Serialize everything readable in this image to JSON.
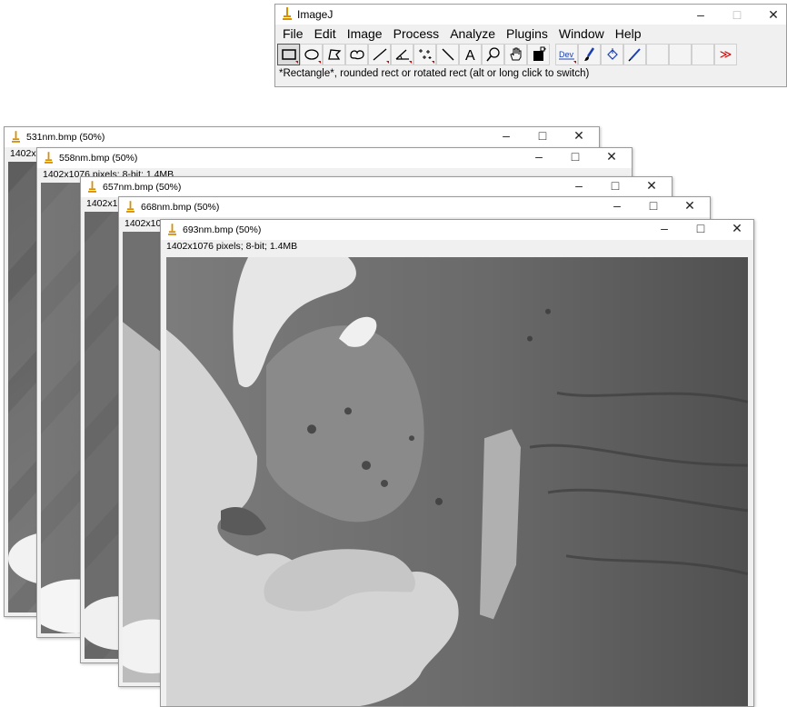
{
  "main": {
    "title": "ImageJ",
    "menus": [
      "File",
      "Edit",
      "Image",
      "Process",
      "Analyze",
      "Plugins",
      "Window",
      "Help"
    ],
    "toolbar": {
      "dev_label": "Dev",
      "overflow": "≫"
    },
    "status": "*Rectangle*, rounded rect or rotated rect (alt or long click to switch)",
    "controls": {
      "minimize": "–",
      "maximize": "□",
      "close": "✕"
    }
  },
  "windows": [
    {
      "title": "531nm.bmp (50%)",
      "info": "1402x"
    },
    {
      "title": "558nm.bmp (50%)",
      "info": "1402x1076 pixels; 8-bit; 1.4MB"
    },
    {
      "title": "657nm.bmp (50%)",
      "info": "1402x1"
    },
    {
      "title": "668nm.bmp (50%)",
      "info": "1402x10"
    },
    {
      "title": "693nm.bmp (50%)",
      "info": "1402x1076 pixels; 8-bit; 1.4MB"
    }
  ],
  "colors": {
    "ij_icon": "#d89000",
    "dropdown_marker": "#d40000",
    "image_gray": "#707070"
  }
}
